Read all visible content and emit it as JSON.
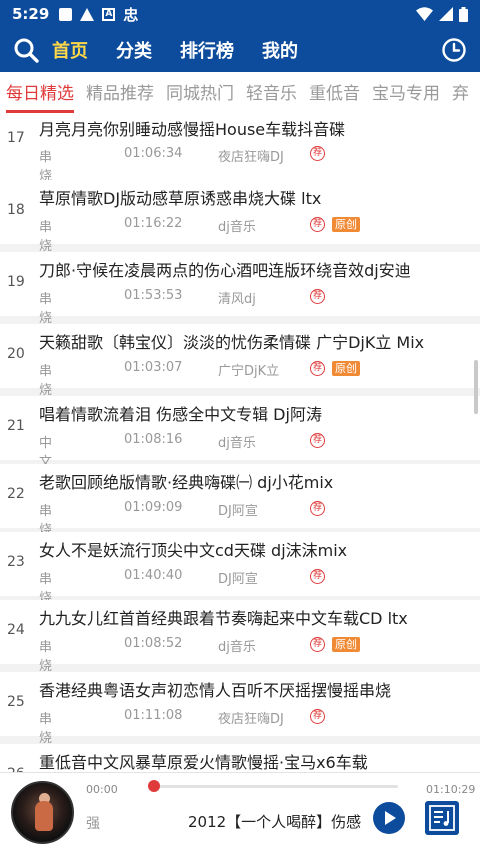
{
  "status": {
    "time": "5:29",
    "app_glyph": "忠"
  },
  "nav": {
    "tabs": [
      {
        "label": "首页",
        "active": true
      },
      {
        "label": "分类",
        "active": false
      },
      {
        "label": "排行榜",
        "active": false
      },
      {
        "label": "我的",
        "active": false
      }
    ]
  },
  "categories": [
    {
      "label": "每日精选",
      "active": true
    },
    {
      "label": "精品推荐"
    },
    {
      "label": "同城热门"
    },
    {
      "label": "轻音乐"
    },
    {
      "label": "重低音"
    },
    {
      "label": "宝马专用"
    },
    {
      "label": "弃"
    }
  ],
  "songs": [
    {
      "num": "17",
      "title": "月亮月亮你别睡动感慢摇House车载抖音碟",
      "genre": "串烧舞曲",
      "duration": "01:06:34",
      "author": "夜店狂嗨DJ",
      "rec": "荐",
      "original": ""
    },
    {
      "num": "18",
      "title": "草原情歌DJ版动感草原诱惑串烧大碟 ltx",
      "genre": "串烧舞曲",
      "duration": "01:16:22",
      "author": "dj音乐",
      "rec": "荐",
      "original": "原创"
    },
    {
      "num": "19",
      "title": "刀郎·守候在凌晨两点的伤心酒吧连版环绕音效dj安迪",
      "genre": "串烧舞曲",
      "duration": "01:53:53",
      "author": "清风dj",
      "rec": "荐",
      "original": ""
    },
    {
      "num": "20",
      "title": "天籁甜歌〔韩宝仪〕淡淡的忧伤柔情碟 广宁DjK立 Mix",
      "genre": "串烧舞曲",
      "duration": "01:03:07",
      "author": "广宁DjK立",
      "rec": "荐",
      "original": "原创"
    },
    {
      "num": "21",
      "title": "唱着情歌流着泪 伤感全中文专辑 Dj阿涛",
      "genre": "中文舞曲",
      "duration": "01:08:16",
      "author": "dj音乐",
      "rec": "荐",
      "original": ""
    },
    {
      "num": "22",
      "title": "老歌回顾绝版情歌·经典嗨碟㈠ dj小花mix",
      "genre": "串烧舞曲",
      "duration": "01:09:09",
      "author": "DJ阿宣",
      "rec": "荐",
      "original": ""
    },
    {
      "num": "23",
      "title": "女人不是妖流行顶尖中文cd天碟 dj沫沫mix",
      "genre": "串烧舞曲",
      "duration": "01:40:40",
      "author": "DJ阿宣",
      "rec": "荐",
      "original": ""
    },
    {
      "num": "24",
      "title": "九九女儿红首首经典跟着节奏嗨起来中文车载CD ltx",
      "genre": "串烧舞曲",
      "duration": "01:08:52",
      "author": "dj音乐",
      "rec": "荐",
      "original": "原创"
    },
    {
      "num": "25",
      "title": "香港经典粤语女声初恋情人百听不厌摇摆慢摇串烧",
      "genre": "串烧舞曲",
      "duration": "01:11:08",
      "author": "夜店狂嗨DJ",
      "rec": "荐",
      "original": ""
    },
    {
      "num": "26",
      "title": "重低音中文风暴草原爱火情歌慢摇·宝马x6车载",
      "genre": "",
      "duration": "",
      "author": "",
      "rec": "",
      "original": ""
    }
  ],
  "player": {
    "elapsed": "00:00",
    "total": "01:10:29",
    "progress": 0.01,
    "marquee_tail": "强",
    "now_playing": "2012【一个人喝醉】伤感"
  },
  "colors": {
    "primary": "#0d4c9c",
    "active_tab": "#ffd84a",
    "accent": "#e03b3b",
    "badge": "#f08a35"
  }
}
